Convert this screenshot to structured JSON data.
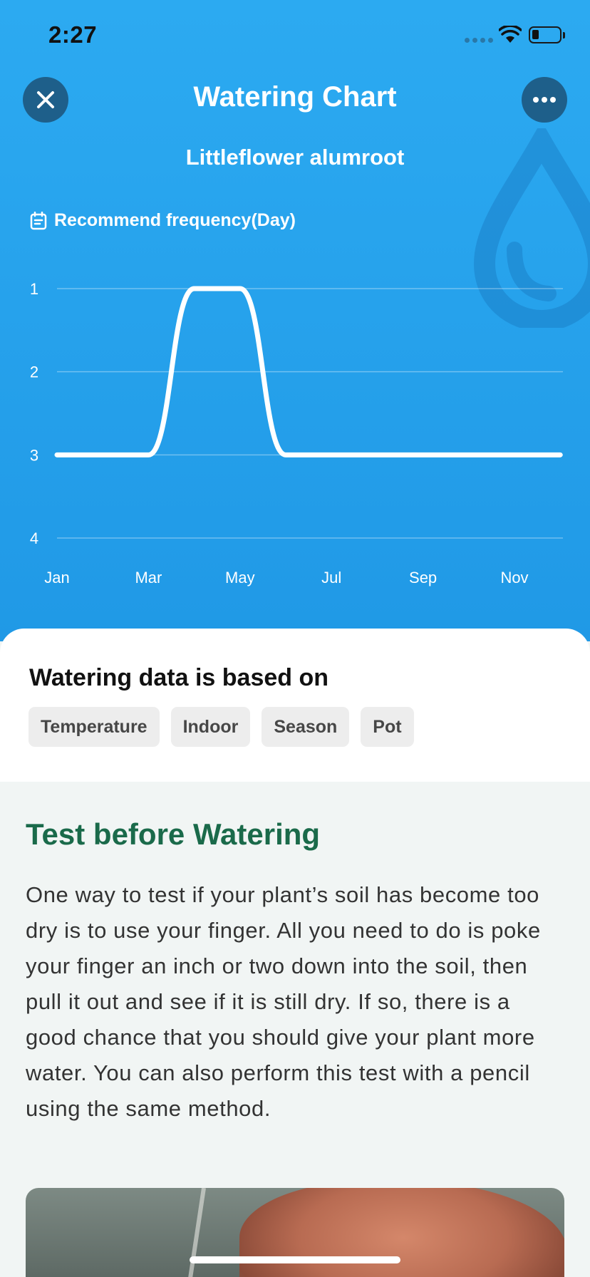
{
  "status_bar": {
    "time": "2:27"
  },
  "header": {
    "title": "Watering Chart",
    "subtitle": "Littleflower alumroot"
  },
  "icons": {
    "close": "close-icon",
    "more": "more-icon",
    "calendar": "calendar-icon",
    "drop": "water-drop-icon"
  },
  "chart": {
    "label": "Recommend frequency(Day)"
  },
  "chart_data": {
    "type": "line",
    "title": "",
    "xlabel": "",
    "ylabel": "Recommend frequency(Day)",
    "x_ticks": [
      "Jan",
      "Mar",
      "May",
      "Jul",
      "Sep",
      "Nov"
    ],
    "y_ticks": [
      "1",
      "2",
      "3",
      "4"
    ],
    "ylim": [
      1,
      4
    ],
    "y_inverted": true,
    "grid": true,
    "series": [
      {
        "values": [
          {
            "x": "Jan",
            "y": 3
          },
          {
            "x": "Mar",
            "y": 3
          },
          {
            "x": "Apr",
            "y": 1
          },
          {
            "x": "May",
            "y": 1
          },
          {
            "x": "Jun",
            "y": 3
          },
          {
            "x": "Jul",
            "y": 3
          },
          {
            "x": "Sep",
            "y": 3
          },
          {
            "x": "Nov",
            "y": 3
          },
          {
            "x": "Dec",
            "y": 3
          }
        ]
      }
    ],
    "line_color": "#ffffff"
  },
  "basis": {
    "title": "Watering data is based on",
    "tags": [
      "Temperature",
      "Indoor",
      "Season",
      "Pot"
    ]
  },
  "tip": {
    "title": "Test before Watering",
    "body": "One way to test if your plant’s soil has become too dry is to use your finger. All you need to do is poke your finger an inch or two down into the soil, then pull it out and see if it is still dry. If so, there is a good chance that you should give your plant more water. You can also perform this test with a pencil using the same method."
  },
  "colors": {
    "hero_bg": "#2aa6ef",
    "title_green": "#1a6a4a",
    "button_dark": "#1e5f8a"
  }
}
